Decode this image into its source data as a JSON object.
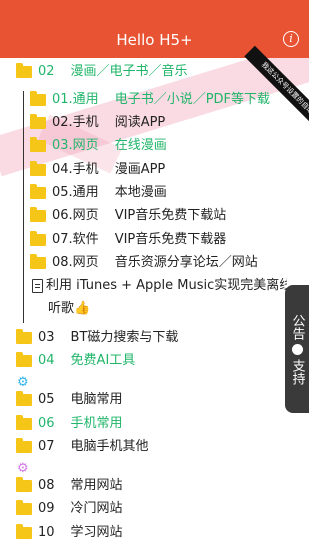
{
  "header": {
    "title": "Hello H5+",
    "info_icon": "info-icon",
    "info_glyph": "i"
  },
  "ribbon": {
    "text": "我这公众号设置的自动回复"
  },
  "tree": {
    "root": {
      "num": "02",
      "label": "漫画／电子书／音乐"
    },
    "children": [
      {
        "num": "01.通用",
        "label": "电子书／小说／PDF等下载",
        "active": true
      },
      {
        "num": "02.手机",
        "label": "阅读APP",
        "active": false
      },
      {
        "num": "03.网页",
        "label": "在线漫画",
        "active": true
      },
      {
        "num": "04.手机",
        "label": "漫画APP",
        "active": false
      },
      {
        "num": "05.通用",
        "label": "本地漫画",
        "active": false
      },
      {
        "num": "06.网页",
        "label": "VIP音乐免费下载站",
        "active": false
      },
      {
        "num": "07.软件",
        "label": "VIP音乐免费下载器",
        "active": false
      },
      {
        "num": "08.网页",
        "label": "音乐资源分享论坛／网站",
        "active": false
      }
    ],
    "doc": {
      "line1": "利用 iTunes + Apple Music实现完美离线",
      "line2": "听歌👍"
    }
  },
  "folders": [
    {
      "num": "03",
      "label": "BT磁力搜索与下载",
      "active": false
    },
    {
      "num": "04",
      "label": "免费AI工具",
      "active": true
    },
    {
      "num": "05",
      "label": "电脑常用",
      "active": false
    },
    {
      "num": "06",
      "label": "手机常用",
      "active": true
    },
    {
      "num": "07",
      "label": "电脑手机其他",
      "active": false
    },
    {
      "num": "08",
      "label": "常用网站",
      "active": false
    },
    {
      "num": "09",
      "label": "冷门网站",
      "active": false
    },
    {
      "num": "10",
      "label": "学习网站",
      "active": false
    }
  ],
  "gears": [
    {
      "icon": "gear-icon",
      "glyph": "⚙",
      "color": "#2fb4e8"
    },
    {
      "icon": "gear-icon",
      "glyph": "⚙",
      "color": "#d47ae6"
    }
  ],
  "side_tab": {
    "top": "公告",
    "bottom": "支持"
  },
  "colors": {
    "header_bg": "#e85433",
    "active_text": "#21b56a",
    "folder": "#f5c518"
  }
}
